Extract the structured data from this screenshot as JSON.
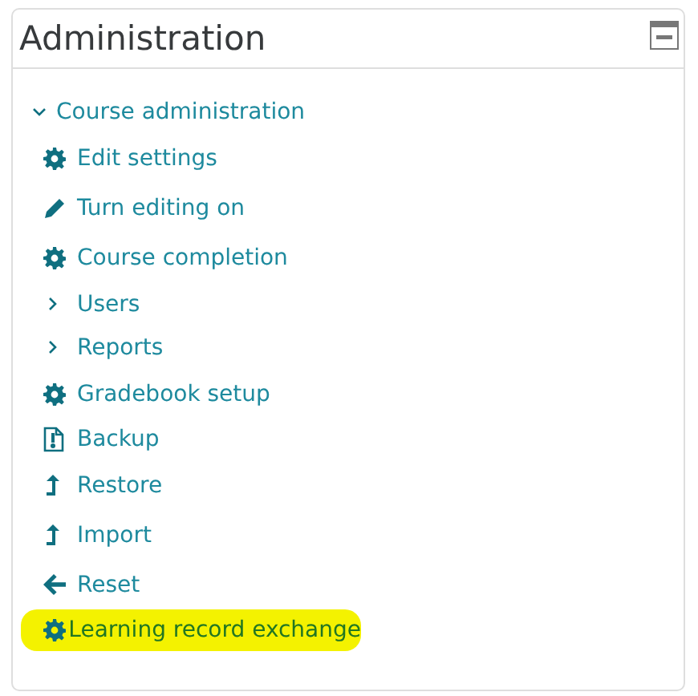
{
  "block": {
    "title": "Administration",
    "collapsed": false
  },
  "tree": {
    "label": "Course administration",
    "expanded": true,
    "children": [
      {
        "label": "Edit settings",
        "kind": "gear",
        "highlighted": false
      },
      {
        "label": "Turn editing on",
        "kind": "pencil",
        "highlighted": false
      },
      {
        "label": "Course completion",
        "kind": "gear",
        "highlighted": false
      },
      {
        "label": "Users",
        "kind": "branch",
        "expanded": false,
        "highlighted": false
      },
      {
        "label": "Reports",
        "kind": "branch",
        "expanded": false,
        "highlighted": false
      },
      {
        "label": "Gradebook setup",
        "kind": "gear",
        "highlighted": false
      },
      {
        "label": "Backup",
        "kind": "archive",
        "highlighted": false
      },
      {
        "label": "Restore",
        "kind": "upload",
        "highlighted": false
      },
      {
        "label": "Import",
        "kind": "upload",
        "highlighted": false
      },
      {
        "label": "Reset",
        "kind": "back",
        "highlighted": false
      },
      {
        "label": "Learning record exchange",
        "kind": "gear",
        "highlighted": true
      }
    ]
  }
}
